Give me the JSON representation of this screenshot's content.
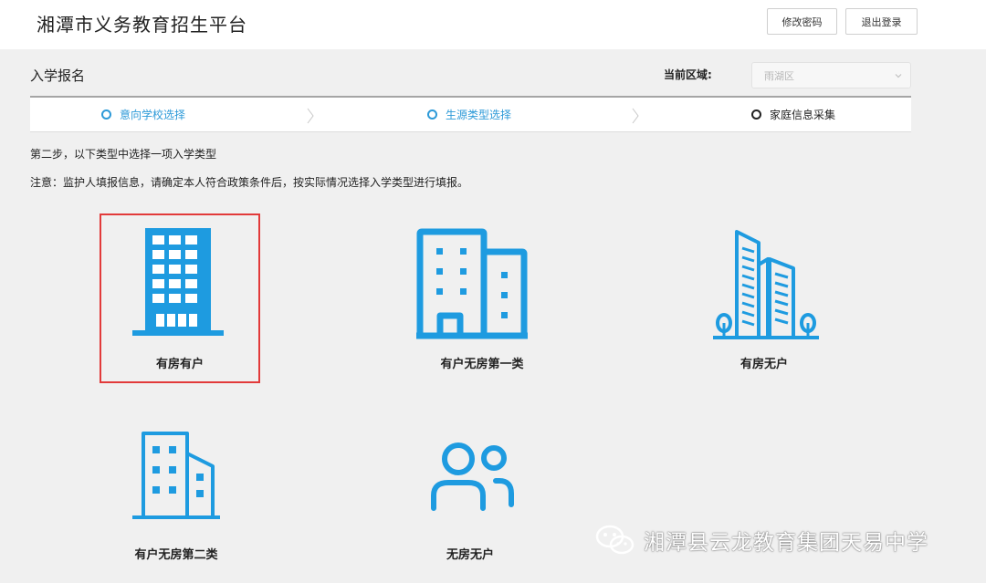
{
  "header": {
    "title": "湘潭市义务教育招生平台",
    "change_password_label": "修改密码",
    "logout_label": "退出登录"
  },
  "page": {
    "heading": "入学报名",
    "region_label": "当前区域:",
    "region_value": "雨湖区"
  },
  "steps": [
    {
      "label": "意向学校选择",
      "state": "done"
    },
    {
      "label": "生源类型选择",
      "state": "current"
    },
    {
      "label": "家庭信息采集",
      "state": "pending"
    }
  ],
  "instruction": "第二步，以下类型中选择一项入学类型",
  "notice": "注意：监护人填报信息，请确定本人符合政策条件后，按实际情况选择入学类型进行填报。",
  "options": [
    {
      "label": "有房有户",
      "icon": "office-tower-icon",
      "selected": true
    },
    {
      "label": "有户无房第一类",
      "icon": "twin-buildings-icon",
      "selected": false
    },
    {
      "label": "有房无户",
      "icon": "high-rise-trees-icon",
      "selected": false
    },
    {
      "label": "有户无房第二类",
      "icon": "building-annex-icon",
      "selected": false
    },
    {
      "label": "无房无户",
      "icon": "people-icon",
      "selected": false
    }
  ],
  "watermark": "湘潭县云龙教育集团天易中学",
  "colors": {
    "accent": "#2d9ad8",
    "icon": "#1e9be0",
    "selected_border": "#e23a3a"
  }
}
